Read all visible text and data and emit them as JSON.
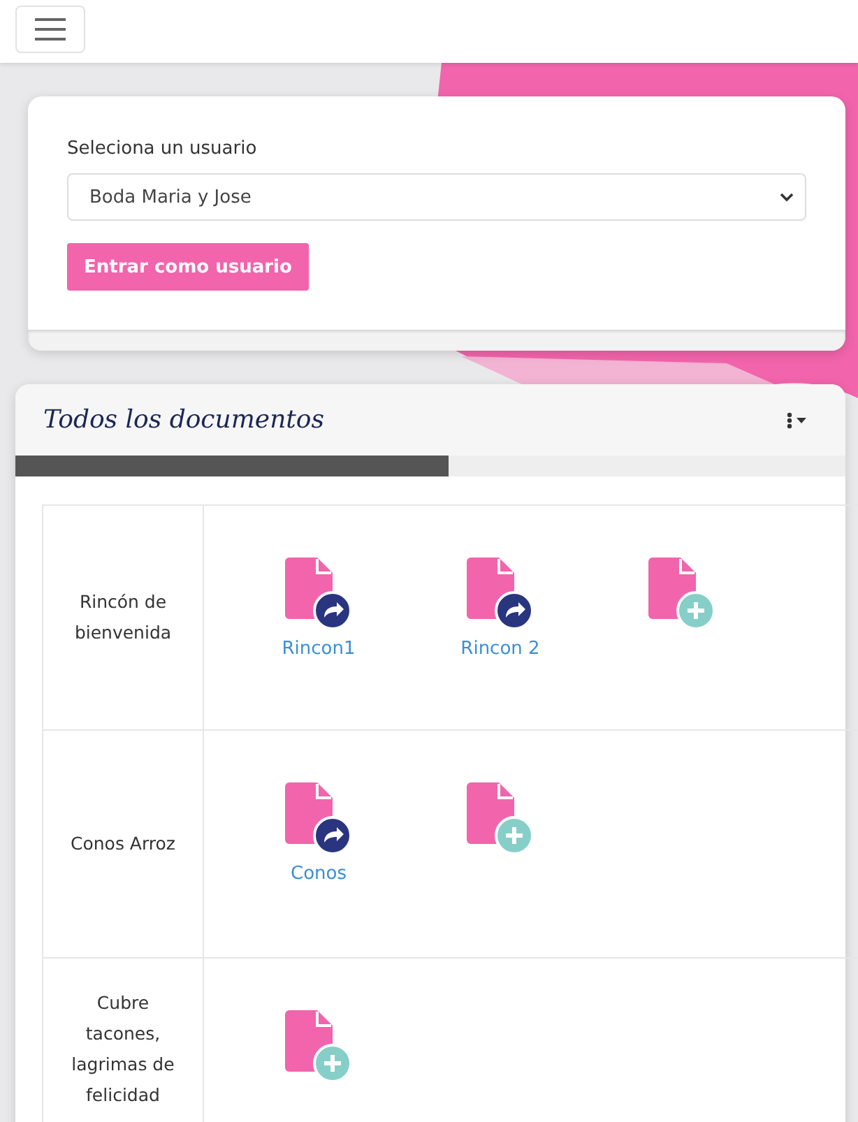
{
  "user_card": {
    "label": "Seleciona un usuario",
    "select_value": "Boda Maria y Jose",
    "button": "Entrar como usuario"
  },
  "documents_panel": {
    "title": "Todos los documentos",
    "rows": [
      {
        "category": "Rincón de bienvenida",
        "documents": [
          {
            "kind": "link",
            "label": "Rincon1"
          },
          {
            "kind": "link",
            "label": "Rincon 2"
          },
          {
            "kind": "add"
          }
        ]
      },
      {
        "category": "Conos Arroz",
        "documents": [
          {
            "kind": "link",
            "label": "Conos"
          },
          {
            "kind": "add"
          }
        ]
      },
      {
        "category": "Cubre tacones, lagrimas de felicidad",
        "documents": [
          {
            "kind": "add"
          }
        ]
      }
    ]
  }
}
